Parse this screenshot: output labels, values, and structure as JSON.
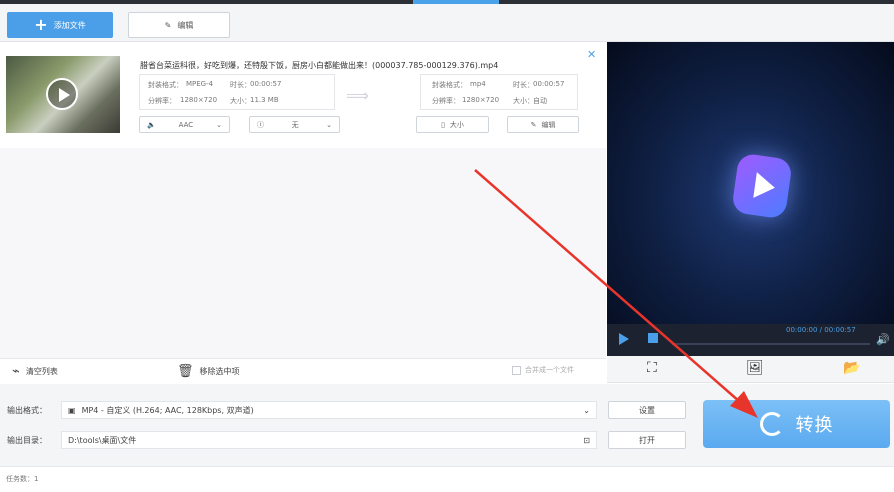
{
  "toolbar": {
    "add_file_label": "添加文件",
    "edit_label": "编辑"
  },
  "file": {
    "title": "腊省台菜运科很，好吃到爆，还特殷下饭，厨房小白都能做出来！(000037.785-000129.376).mp4",
    "source": {
      "format_label": "封装格式：",
      "format": "MPEG-4",
      "duration_label": "时长：",
      "duration": "00:00:57",
      "resolution_label": "分辨率：",
      "resolution": "1280×720",
      "size_label": "大小：",
      "size": "11.3 MB"
    },
    "output": {
      "format_label": "封装格式：",
      "format": "mp4",
      "duration_label": "时长：",
      "duration": "00:00:57",
      "resolution_label": "分辨率：",
      "resolution": "1280×720",
      "size_label": "大小：",
      "size": "自动"
    },
    "audio_select": "AAC",
    "subtitle_select": "无",
    "size_button": "大小",
    "edit_button": "编辑"
  },
  "list_footer": {
    "clear_label": "清空列表",
    "remove_label": "移除选中项",
    "merge_label": "合并成一个文件"
  },
  "player": {
    "time": "00:00:00 / 00:00:57",
    "progress": 0
  },
  "bottom": {
    "format_label": "输出格式：",
    "format_value": "MP4 - 自定义 (H.264; AAC, 128Kbps, 双声道)",
    "settings_button": "设置",
    "dir_label": "输出目录：",
    "dir_value": "D:\\tools\\桌面\\文件",
    "open_button": "打开",
    "convert_button": "转换"
  },
  "status": {
    "task_count": "任务数：1"
  },
  "colors": {
    "accent": "#4a9fe8",
    "convert": "#6bb4f2",
    "annotation": "#e8352c"
  }
}
